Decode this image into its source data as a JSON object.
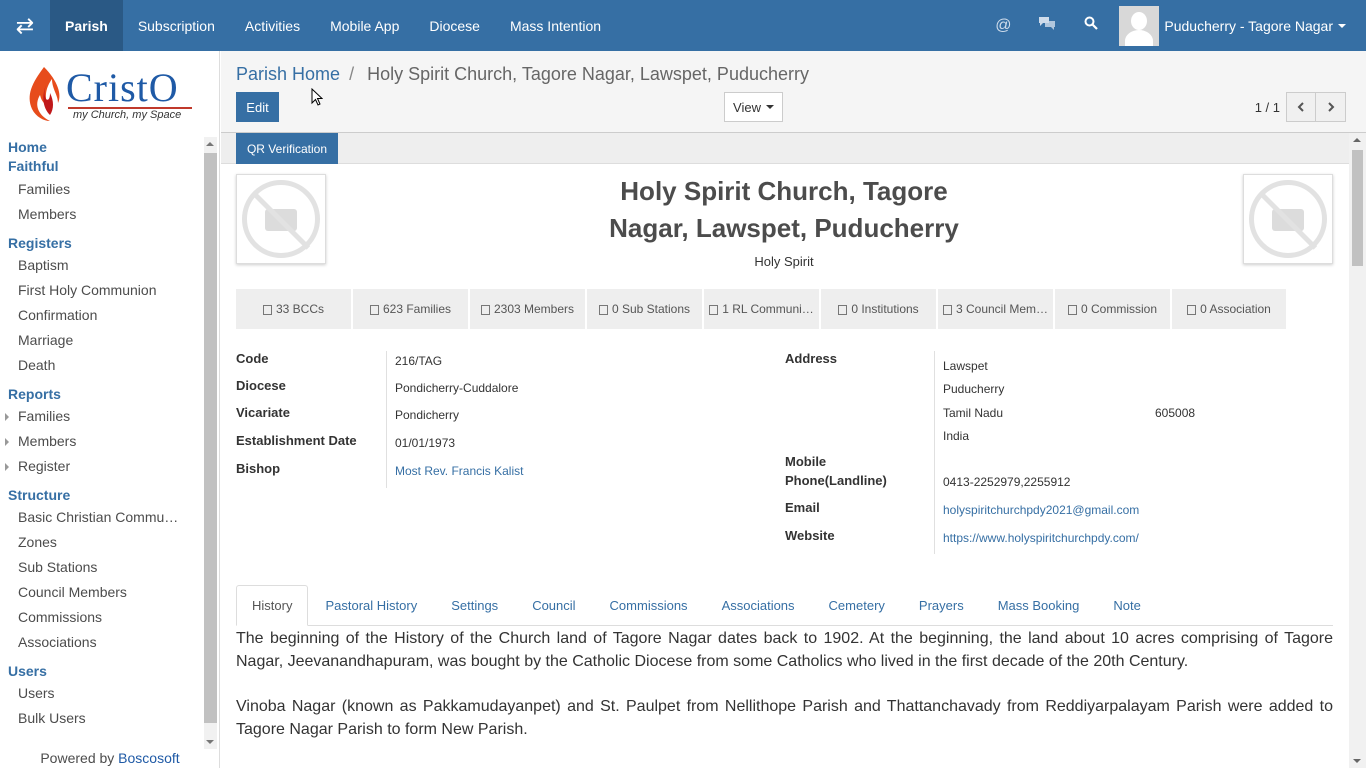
{
  "topbar": {
    "menu": [
      {
        "label": "Parish",
        "active": true
      },
      {
        "label": "Subscription",
        "active": false
      },
      {
        "label": "Activities",
        "active": false
      },
      {
        "label": "Mobile App",
        "active": false
      },
      {
        "label": "Diocese",
        "active": false
      },
      {
        "label": "Mass Intention",
        "active": false
      }
    ],
    "user": "Puducherry - Tagore Nagar",
    "icons": [
      "toggle-apps-icon",
      "at-sign-icon",
      "chat-icon",
      "search-icon"
    ]
  },
  "sidebar": {
    "logo": {
      "brand": "CristO",
      "tagline": "my Church, my Space"
    },
    "sections": [
      {
        "title": "Home",
        "items": []
      },
      {
        "title": "Faithful",
        "items": [
          "Families",
          "Members"
        ]
      },
      {
        "title": "Registers",
        "items": [
          "Baptism",
          "First Holy Communion",
          "Confirmation",
          "Marriage",
          "Death"
        ]
      },
      {
        "title": "Reports",
        "items": [
          "Families",
          "Members",
          "Register"
        ]
      },
      {
        "title": "Structure",
        "items": [
          "Basic Christian Commu…",
          "Zones",
          "Sub Stations",
          "Council Members",
          "Commissions",
          "Associations"
        ]
      },
      {
        "title": "Users",
        "items": [
          "Users",
          "Bulk Users"
        ]
      }
    ],
    "powered_prefix": "Powered by",
    "powered_brand": "Boscosoft"
  },
  "control": {
    "breadcrumb_home": "Parish Home",
    "breadcrumb_sep": "/",
    "breadcrumb_current": "Holy Spirit Church, Tagore Nagar, Lawspet, Puducherry",
    "edit_label": "Edit",
    "view_label": "View",
    "pager_value": "1 / 1"
  },
  "sheet": {
    "qr_label": "QR Verification",
    "title_line1": "Holy Spirit Church, Tagore",
    "title_line2": "Nagar, Lawspet, Puducherry",
    "subtitle": "Holy Spirit",
    "smart_buttons": [
      "33 BCCs",
      "623 Families",
      "2303 Members",
      "0 Sub Stations",
      "1 RL Communi…",
      "0 Institutions",
      "3 Council Mem…",
      "0 Commission",
      "0 Association"
    ],
    "left_fields": [
      {
        "label": "Code",
        "value": "216/TAG"
      },
      {
        "label": "Diocese",
        "value": "Pondicherry-Cuddalore"
      },
      {
        "label": "Vicariate",
        "value": "Pondicherry"
      },
      {
        "label": "Establishment Date",
        "value": "01/01/1973"
      },
      {
        "label": "Bishop",
        "value": "Most Rev. Francis Kalist"
      }
    ],
    "address": {
      "label": "Address",
      "street": "Lawspet",
      "city": "Puducherry",
      "state": "Tamil Nadu",
      "zip": "605008",
      "country": "India"
    },
    "right_fields": [
      {
        "label": "Mobile",
        "value": ""
      },
      {
        "label": "Phone(Landline)",
        "value": "0413-2252979,2255912"
      },
      {
        "label": "Email",
        "value": "holyspiritchurchpdy2021@gmail.com"
      },
      {
        "label": "Website",
        "value": "https://www.holyspiritchurchpdy.com/"
      }
    ],
    "tabs": [
      "History",
      "Pastoral History",
      "Settings",
      "Council",
      "Commissions",
      "Associations",
      "Cemetery",
      "Prayers",
      "Mass Booking",
      "Note"
    ],
    "history": [
      "The beginning of the History of the Church land of Tagore Nagar dates back to 1902. At the beginning, the land about 10 acres comprising of Tagore Nagar, Jeevanandhapuram, was bought by the Catholic Diocese from some Catholics who lived in the first decade of the 20th Century.",
      "Vinoba Nagar (known as Pakkamudayanpet) and St. Paulpet from Nellithope Parish and Thattanchavady from Reddiyarpalayam Parish were  added to Tagore Nagar Parish to form New Parish."
    ]
  }
}
